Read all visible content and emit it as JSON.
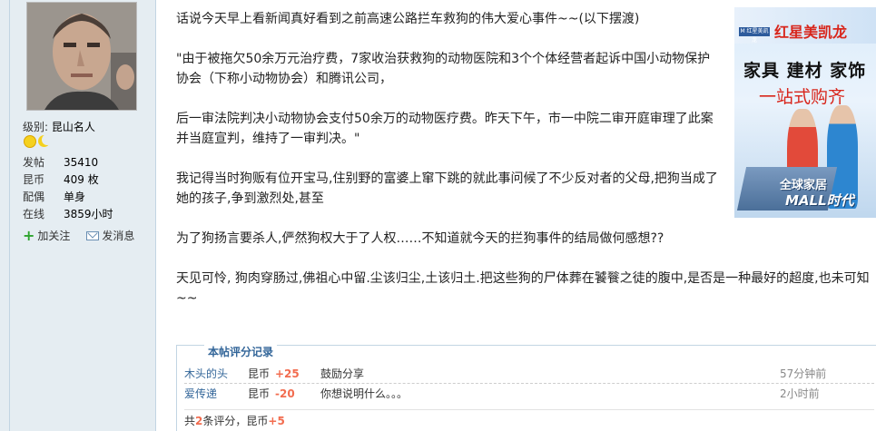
{
  "user": {
    "rank_label": "级别:",
    "rank_name": "昆山名人",
    "stats": [
      {
        "label": "发帖",
        "value": "35410"
      },
      {
        "label": "昆币",
        "value": "409 枚"
      },
      {
        "label": "配偶",
        "value": "单身"
      },
      {
        "label": "在线",
        "value": "3859小时"
      }
    ],
    "follow_label": "加关注",
    "message_label": "发消息"
  },
  "post": {
    "paragraphs": [
      "话说今天早上看新闻真好看到之前高速公路拦车救狗的伟大爱心事件~~(以下摆渡)",
      "\"由于被拖欠50余万元治疗费，7家收治获救狗的动物医院和3个个体经营者起诉中国小动物保护协会（下称小动物协会）和腾讯公司，",
      "后一审法院判决小动物协会支付50余万的动物医疗费。昨天下午，市一中院二审开庭审理了此案并当庭宣判，维持了一审判决。\"",
      "我记得当时狗贩有位开宝马,住别野的富婆上窜下跳的就此事问候了不少反对者的父母,把狗当成了她的孩子,争到激烈处,甚至",
      "为了狗扬言要杀人,俨然狗权大于了人权……不知道就今天的拦狗事件的结局做何感想??",
      "天见可怜, 狗肉穿肠过,佛祖心中留.尘该归尘,土该归土.把这些狗的尸体葬在饕餮之徒的腹中,是否是一种最好的超度,也未可知~~"
    ]
  },
  "ad": {
    "logo": "M 红星美凯龙",
    "brand": "红星美凯龙",
    "line1": "家具 建材 家饰",
    "line2": "一站式购齐",
    "slogan1": "全球家居",
    "slogan2": "MALL时代"
  },
  "rating": {
    "title": "本帖评分记录",
    "rows": [
      {
        "user": "木头的头",
        "currency": "昆币",
        "points": "+25",
        "reason": "鼓励分享",
        "time": "57分钟前"
      },
      {
        "user": "爱传递",
        "currency": "昆币",
        "points": "-20",
        "reason": "你想说明什么。。。",
        "time": "2小时前"
      }
    ],
    "summary_prefix": "共",
    "summary_count": "2",
    "summary_mid": "条评分，昆币",
    "summary_total": "+5"
  },
  "colors": {
    "sidebar_bg": "#e5edf2",
    "link": "#336699",
    "points": "#f26c4f"
  }
}
